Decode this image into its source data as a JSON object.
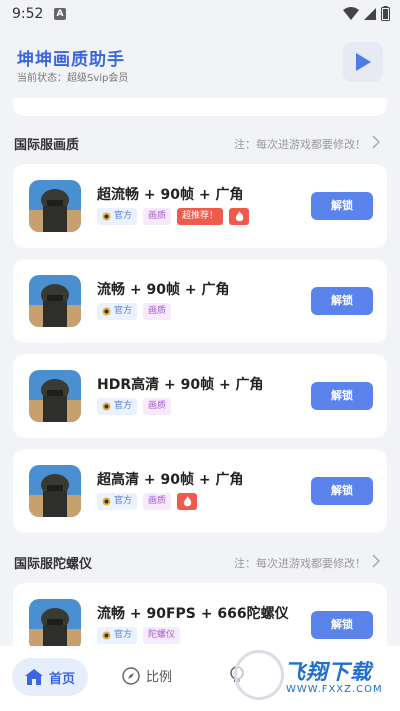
{
  "status": {
    "time": "9:52",
    "notif_icon": "A"
  },
  "header": {
    "title": "坤坤画质助手",
    "subtitle": "当前状态：超级Svip会员"
  },
  "sections": [
    {
      "title": "国际服画质",
      "note": "注：每次进游戏都要修改！"
    },
    {
      "title": "国际服陀螺仪",
      "note": "注：每次进游戏都要修改！"
    }
  ],
  "cards": [
    {
      "title": "超流畅 + 90帧 + 广角",
      "tag_official": "官方",
      "tag_type": "画质",
      "tag_hot": "超推荐！",
      "unlock": "解锁"
    },
    {
      "title": "流畅 + 90帧 + 广角",
      "tag_official": "官方",
      "tag_type": "画质",
      "unlock": "解锁"
    },
    {
      "title": "HDR高清 + 90帧 + 广角",
      "tag_official": "官方",
      "tag_type": "画质",
      "unlock": "解锁"
    },
    {
      "title": "超高清 + 90帧 + 广角",
      "tag_official": "官方",
      "tag_type": "画质",
      "unlock": "解锁"
    },
    {
      "title": "流畅 + 90FPS + 666陀螺仪",
      "tag_official": "官方",
      "tag_type": "陀螺仪",
      "unlock": "解锁"
    }
  ],
  "tabs": {
    "home": "首页",
    "ratio": "比例"
  },
  "watermark": {
    "text": "飞翔下载",
    "url": "WWW.FXXZ.COM"
  },
  "colors": {
    "accent": "#3b66e0",
    "button": "#5b83ec",
    "hot": "#f05a4a"
  }
}
